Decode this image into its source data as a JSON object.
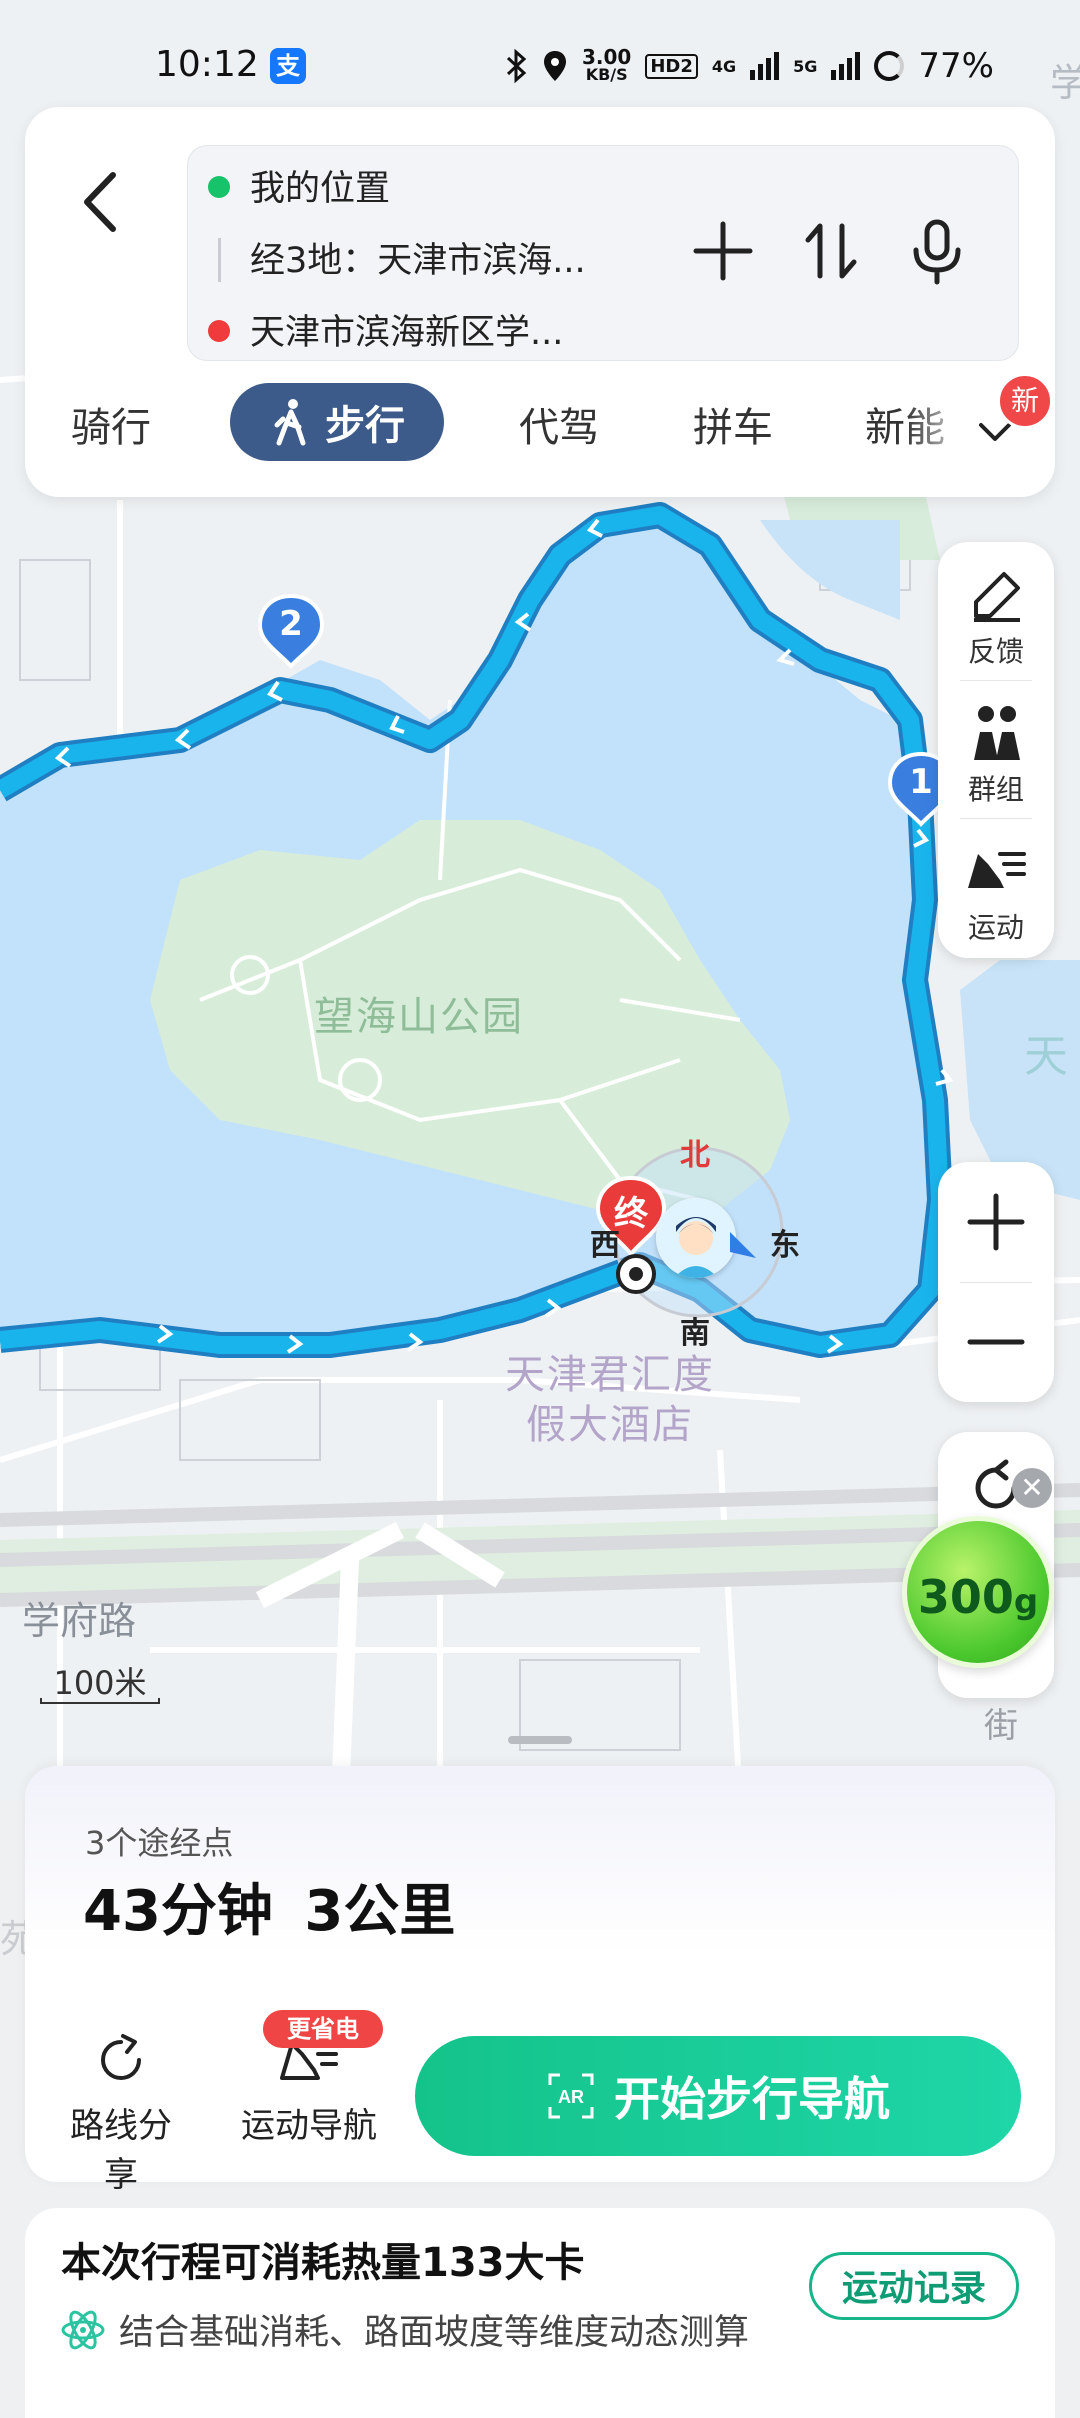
{
  "status_bar": {
    "time": "10:12",
    "app_badge": "支",
    "net_speed_value": "3.00",
    "net_speed_unit": "KB/S",
    "hd": "HD2",
    "sig1": "4G",
    "sig2": "5G",
    "battery": "77%"
  },
  "route": {
    "origin": "我的位置",
    "via": "经3地：天津市滨海...",
    "destination": "天津市滨海新区学..."
  },
  "modes": [
    "骑行",
    "步行",
    "代驾",
    "拼车",
    "新能"
  ],
  "new_badge": "新",
  "map": {
    "park": "望海山公园",
    "hotel_line1": "天津君汇度",
    "hotel_line2": "假大酒店",
    "road": "学府路",
    "scale": "100米",
    "edge_right_1": "天",
    "edge_right_2": "学",
    "edge_jie": "街",
    "edge_left": "苑",
    "waypoint_1": "1",
    "waypoint_2": "2",
    "end_marker": "终",
    "compass": {
      "n": "北",
      "s": "南",
      "e": "东",
      "w": "西"
    }
  },
  "right_tools": [
    "反馈",
    "群组",
    "运动"
  ],
  "calorie_ball": {
    "value": "300",
    "unit": "g",
    "close": "✕"
  },
  "route_card": {
    "waypoints": "3个途经点",
    "summary": "43分钟  3公里",
    "share_label": "路线分享",
    "sport_nav_label": "运动导航",
    "save_badge": "更省电",
    "start_label": "开始步行导航"
  },
  "calorie_card": {
    "title": "本次行程可消耗热量133大卡",
    "desc": "结合基础消耗、路面坡度等维度动态测算",
    "record_btn": "运动记录"
  },
  "colors": {
    "route": "#18a7e8",
    "water": "#c2e1fa",
    "park": "#d8edd9",
    "accent_green": "#14c38a",
    "active_tab": "#3d5b8a"
  }
}
